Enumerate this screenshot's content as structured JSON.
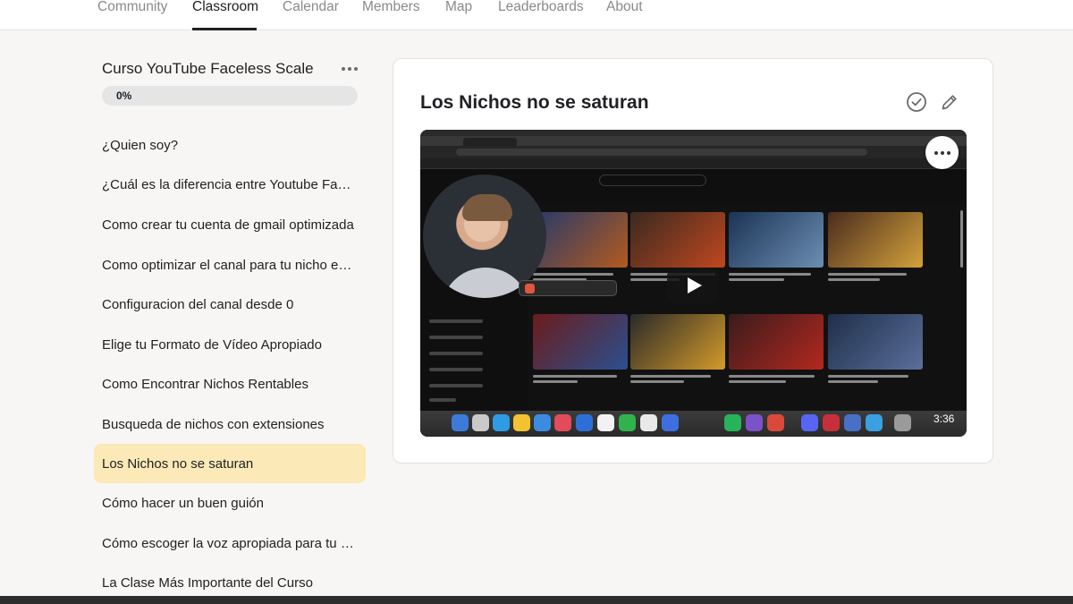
{
  "nav": {
    "tabs": [
      {
        "label": "Community",
        "active": false
      },
      {
        "label": "Classroom",
        "active": true
      },
      {
        "label": "Calendar",
        "active": false
      },
      {
        "label": "Members",
        "active": false
      },
      {
        "label": "Map",
        "active": false
      },
      {
        "label": "Leaderboards",
        "active": false
      },
      {
        "label": "About",
        "active": false
      }
    ]
  },
  "course": {
    "title": "Curso YouTube Faceless Scale",
    "progress_label": "0%",
    "progress": 0,
    "menu_icon": "ellipsis-icon"
  },
  "lessons": [
    {
      "label": "¿Quien soy?",
      "active": false
    },
    {
      "label": "¿Cuál es la diferencia entre Youtube Faceless y Youtube normal?",
      "active": false
    },
    {
      "label": "Como crear tu cuenta de gmail optimizada",
      "active": false
    },
    {
      "label": "Como optimizar el canal para tu nicho específico",
      "active": false
    },
    {
      "label": "Configuracion del canal desde 0",
      "active": false
    },
    {
      "label": "Elige tu Formato de Vídeo Apropiado",
      "active": false
    },
    {
      "label": "Como Encontrar Nichos Rentables",
      "active": false
    },
    {
      "label": "Busqueda de nichos con extensiones",
      "active": false
    },
    {
      "label": "Los Nichos no se saturan",
      "active": true
    },
    {
      "label": "Cómo hacer un buen guión",
      "active": false
    },
    {
      "label": "Cómo escoger la voz apropiada para tu canal",
      "active": false
    },
    {
      "label": "La Clase Más Importante del Curso",
      "active": false
    }
  ],
  "content": {
    "title": "Los Nichos no se saturan",
    "check_icon": "check-circle-icon",
    "edit_icon": "pencil-icon",
    "video": {
      "time": "3:36",
      "play_icon": "play-icon",
      "more_icon": "ellipsis-icon"
    }
  },
  "colors": {
    "accent": "#f3cf75",
    "active_lesson_bg": "#fbe9b7",
    "page_bg": "#f7f6f4"
  }
}
